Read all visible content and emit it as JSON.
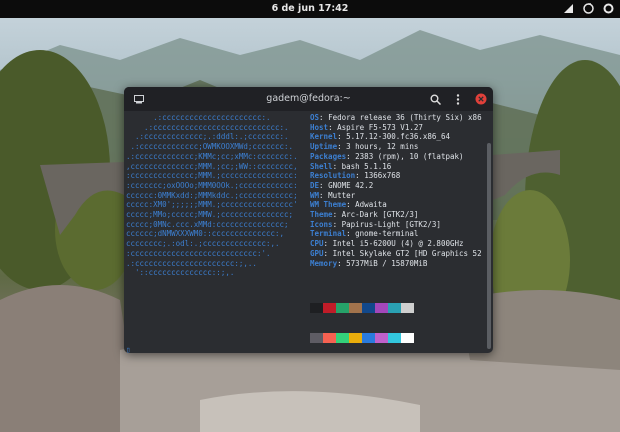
{
  "topbar": {
    "clock": "6 de jun  17:42"
  },
  "window": {
    "title": "gadem@fedora:~",
    "logo_lines": [
      "      .:cccccccccccccccccccccc:.",
      "    .:cccccccccccccccccccccccccccc:.",
      "  .:ccccccccccccc;.:dddl:.;ccccccc:.",
      " .:ccccccccccccc;OWMKOOXMWd;ccccccc:.",
      ".:ccccccccccccc;KMMc;cc;xMMc:ccccccc:.",
      ",cccccccccccccc;MMM.;cc;;WW::cccccccc,",
      ":cccccccccccccc;MMM.;cccccccccccccccc:",
      ":ccccccc;oxOOOo;MMM0OOk.;cccccccccccc:",
      "cccccc:0MMKxdd:;MMMkddc.;cccccccccccc;",
      "ccccc:XM0';;;;;;MMM.;cccccccccccccccc'",
      "ccccc;MMo;ccccc;MMW.;ccccccccccccccc;",
      "ccccc;0MNc.ccc.xMMd:ccccccccccccccc;",
      "cccccc;dNMWXXXWM0::cccccccccccccc:,",
      "cccccccc;.:odl:.;cccccccccccccc:,.",
      ":cccccccccccccccccccccccccccc:'.",
      ".:cccccccccccccccccccccc:;,..",
      "  '::cccccccccccccc::;,."
    ],
    "info": [
      {
        "key": "OS",
        "value": "Fedora release 36 (Thirty Six) x86"
      },
      {
        "key": "Host",
        "value": "Aspire F5-573 V1.27"
      },
      {
        "key": "Kernel",
        "value": "5.17.12-300.fc36.x86_64"
      },
      {
        "key": "Uptime",
        "value": "3 hours, 12 mins"
      },
      {
        "key": "Packages",
        "value": "2383 (rpm), 10 (flatpak)"
      },
      {
        "key": "Shell",
        "value": "bash 5.1.16"
      },
      {
        "key": "Resolution",
        "value": "1366x768"
      },
      {
        "key": "DE",
        "value": "GNOME 42.2"
      },
      {
        "key": "WM",
        "value": "Mutter"
      },
      {
        "key": "WM Theme",
        "value": "Adwaita"
      },
      {
        "key": "Theme",
        "value": "Arc-Dark [GTK2/3]"
      },
      {
        "key": "Icons",
        "value": "Papirus-Light [GTK2/3]"
      },
      {
        "key": "Terminal",
        "value": "gnome-terminal"
      },
      {
        "key": "CPU",
        "value": "Intel i5-6200U (4) @ 2.800GHz"
      },
      {
        "key": "GPU",
        "value": "Intel Skylake GT2 [HD Graphics 52"
      },
      {
        "key": "Memory",
        "value": "5737MiB / 15870MiB"
      }
    ],
    "colors_row1": [
      "#1e1f22",
      "#c01c28",
      "#26a269",
      "#a2734c",
      "#12488b",
      "#a347ba",
      "#2aa1b3",
      "#cfcfcf"
    ],
    "colors_row2": [
      "#5e5c64",
      "#f66151",
      "#33d17a",
      "#e9ad0c",
      "#2a7bde",
      "#c061cb",
      "#33c7de",
      "#ffffff"
    ],
    "prompt": "▯"
  }
}
